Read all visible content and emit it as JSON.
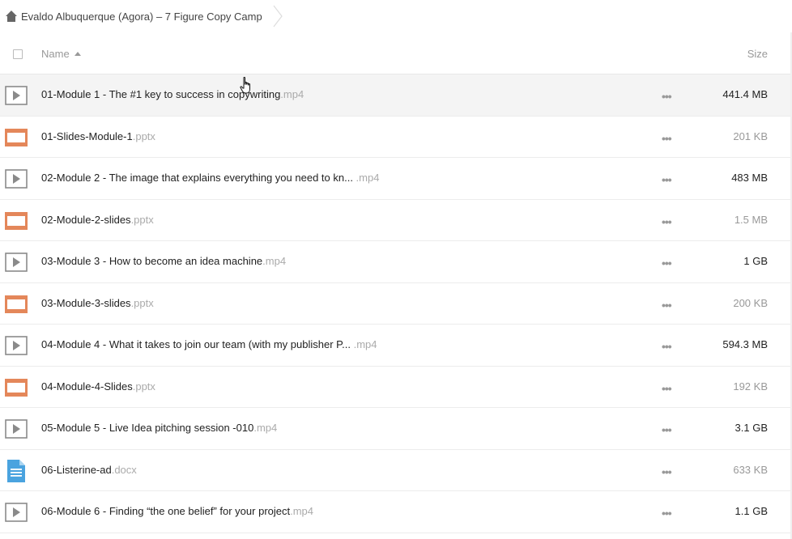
{
  "breadcrumb": {
    "home_icon": "home-icon",
    "label": "Evaldo Albuquerque (Agora) – 7 Figure Copy Camp"
  },
  "header": {
    "name_label": "Name",
    "size_label": "Size",
    "sort": "ascending"
  },
  "colors": {
    "video_icon": "#8a8a8a",
    "slides_icon": "#e4875a",
    "doc_icon": "#4aa3df",
    "row_highlight": "#f4f4f4"
  },
  "files": [
    {
      "name": "01-Module 1 - The #1 key to success in copywriting",
      "ext": ".mp4",
      "size": "441.4 MB",
      "type": "video",
      "size_emphasis": true
    },
    {
      "name": "01-Slides-Module-1",
      "ext": ".pptx",
      "size": "201 KB",
      "type": "slides",
      "size_emphasis": false
    },
    {
      "name": "02-Module 2 - The image that explains everything you need to kn...",
      "ext": " .mp4",
      "size": "483 MB",
      "type": "video",
      "size_emphasis": true
    },
    {
      "name": "02-Module-2-slides",
      "ext": ".pptx",
      "size": "1.5 MB",
      "type": "slides",
      "size_emphasis": false
    },
    {
      "name": "03-Module 3 - How to become an idea machine",
      "ext": ".mp4",
      "size": "1 GB",
      "type": "video",
      "size_emphasis": true
    },
    {
      "name": "03-Module-3-slides",
      "ext": ".pptx",
      "size": "200 KB",
      "type": "slides",
      "size_emphasis": false
    },
    {
      "name": "04-Module 4 - What it takes to join our team (with my publisher P...",
      "ext": " .mp4",
      "size": "594.3 MB",
      "type": "video",
      "size_emphasis": true
    },
    {
      "name": "04-Module-4-Slides",
      "ext": ".pptx",
      "size": "192 KB",
      "type": "slides",
      "size_emphasis": false
    },
    {
      "name": "05-Module 5 - Live Idea pitching session -010",
      "ext": ".mp4",
      "size": "3.1 GB",
      "type": "video",
      "size_emphasis": true
    },
    {
      "name": "06-Listerine-ad",
      "ext": ".docx",
      "size": "633 KB",
      "type": "doc",
      "size_emphasis": false
    },
    {
      "name": "06-Module 6 - Finding “the one belief” for your project",
      "ext": ".mp4",
      "size": "1.1 GB",
      "type": "video",
      "size_emphasis": true
    }
  ]
}
